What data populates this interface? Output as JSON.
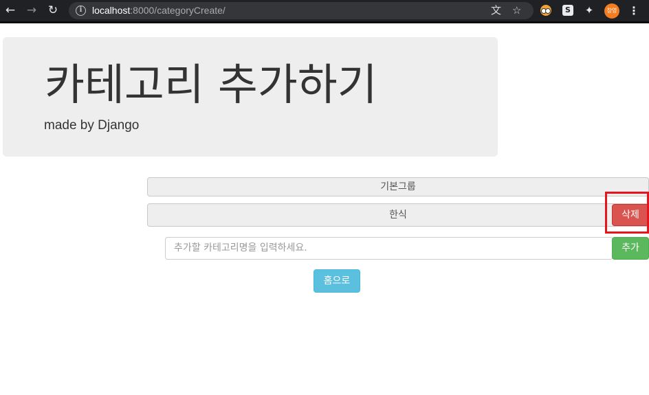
{
  "browser": {
    "url_host": "localhost",
    "url_path": ":8000/categoryCreate/",
    "profile_label": "창영",
    "icons": {
      "back": "back-arrow-icon",
      "forward": "forward-arrow-icon",
      "reload": "reload-icon",
      "info": "info-icon",
      "translate": "translate-icon",
      "bookmark": "star-icon",
      "extension_eyes": "eyes-extension-icon",
      "extension_s": "s-extension-icon",
      "extensions": "puzzle-icon",
      "menu": "vertical-dots-icon"
    },
    "extension_s_label": "S"
  },
  "page": {
    "title": "카테고리 추가하기",
    "subtitle": "made by Django",
    "categories": [
      {
        "name": "기본그룹"
      },
      {
        "name": "한식"
      }
    ],
    "delete_button": "삭제",
    "add_input_placeholder": "추가할 카테고리명을 입력하세요.",
    "add_button": "추가",
    "home_button": "홈으로"
  },
  "colors": {
    "danger": "#d9534f",
    "success": "#5cb85c",
    "info": "#5bc0de",
    "highlight": "#e8141c",
    "jumbotron": "#eeeeee"
  }
}
